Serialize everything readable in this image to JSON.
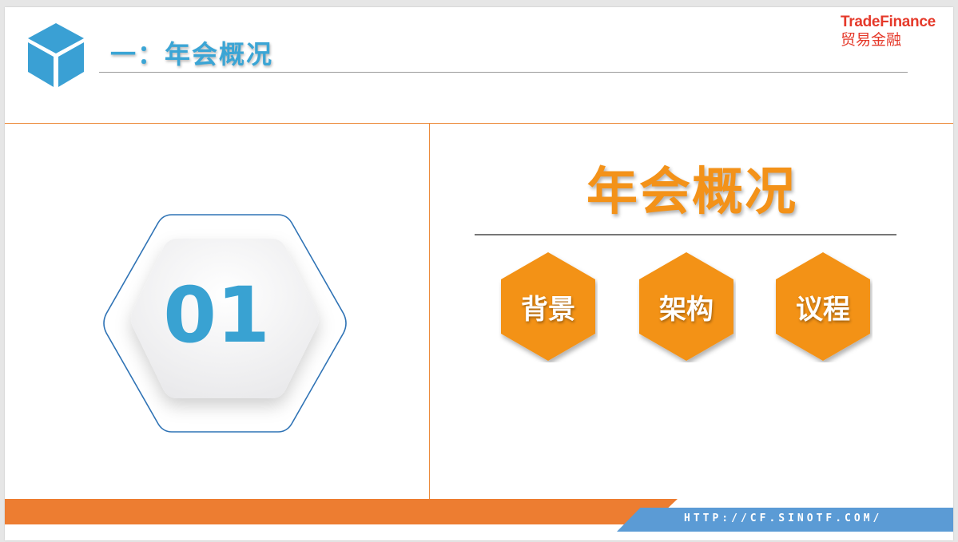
{
  "header": {
    "title": "一：年会概况",
    "brand_en": "TradeFinance",
    "brand_cn": "贸易金融"
  },
  "section": {
    "number": "01",
    "title": "年会概况",
    "items": [
      {
        "label": "背景"
      },
      {
        "label": "架构"
      },
      {
        "label": "议程"
      }
    ]
  },
  "footer": {
    "url": "HTTP://CF.SINOTF.COM/"
  },
  "colors": {
    "accent_blue": "#3ba5d5",
    "accent_orange": "#f39219",
    "brand_red": "#e5392a",
    "bar_orange": "#ed7d31",
    "bar_blue": "#5b9bd5"
  },
  "icons": {
    "header_logo": "cube-icon"
  }
}
